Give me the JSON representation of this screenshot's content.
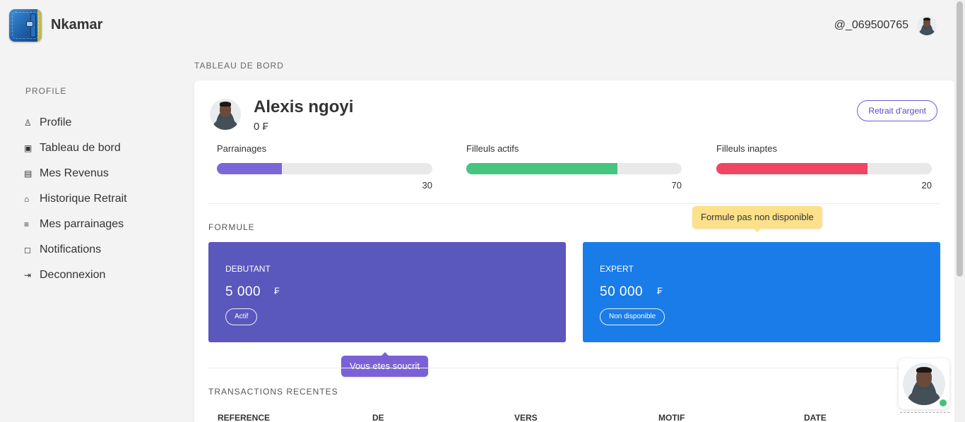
{
  "header": {
    "brand": "Nkamar",
    "user_handle": "@_069500765"
  },
  "sidebar": {
    "title": "PROFILE",
    "items": [
      {
        "label": "Profile",
        "icon": "user-icon",
        "glyph": "♙"
      },
      {
        "label": "Tableau de bord",
        "icon": "id-card-icon",
        "glyph": "▣"
      },
      {
        "label": "Mes Revenus",
        "icon": "money-icon",
        "glyph": "▤"
      },
      {
        "label": "Historique Retrait",
        "icon": "bank-icon",
        "glyph": "⌂"
      },
      {
        "label": "Mes parrainages",
        "icon": "user-list-icon",
        "glyph": "≡"
      },
      {
        "label": "Notifications",
        "icon": "message-icon",
        "glyph": "◻"
      },
      {
        "label": "Deconnexion",
        "icon": "logout-icon",
        "glyph": "⇥"
      }
    ]
  },
  "breadcrumb": "TABLEAU DE BORD",
  "profile_card": {
    "name": "Alexis ngoyi",
    "balance": "0 ₣",
    "withdraw_button": "Retrait d'argent"
  },
  "stats": [
    {
      "label": "Parrainages",
      "value": "30",
      "fill_percent": 30,
      "color": "#7b66d8"
    },
    {
      "label": "Filleuls actifs",
      "value": "70",
      "fill_percent": 70,
      "color": "#45c580"
    },
    {
      "label": "Filleuls inaptes",
      "value": "20",
      "fill_percent": 70,
      "color": "#ee4663"
    }
  ],
  "formule": {
    "title": "FORMULE",
    "plans": [
      {
        "name": "DEBUTANT",
        "price": "5 000",
        "currency": "₣",
        "status": "Actif",
        "color": "#5a57bd"
      },
      {
        "name": "EXPERT",
        "price": "50 000",
        "currency": "₣",
        "status": "Non disponible",
        "color": "#1a7ce8"
      }
    ],
    "tooltip_subscribed": "Vous etes soucrit",
    "tooltip_unavailable": "Formule pas non disponible"
  },
  "transactions": {
    "title": "TRANSACTIONS RECENTES",
    "columns": [
      "REFERENCE",
      "DE",
      "VERS",
      "MOTIF",
      "DATE"
    ]
  }
}
